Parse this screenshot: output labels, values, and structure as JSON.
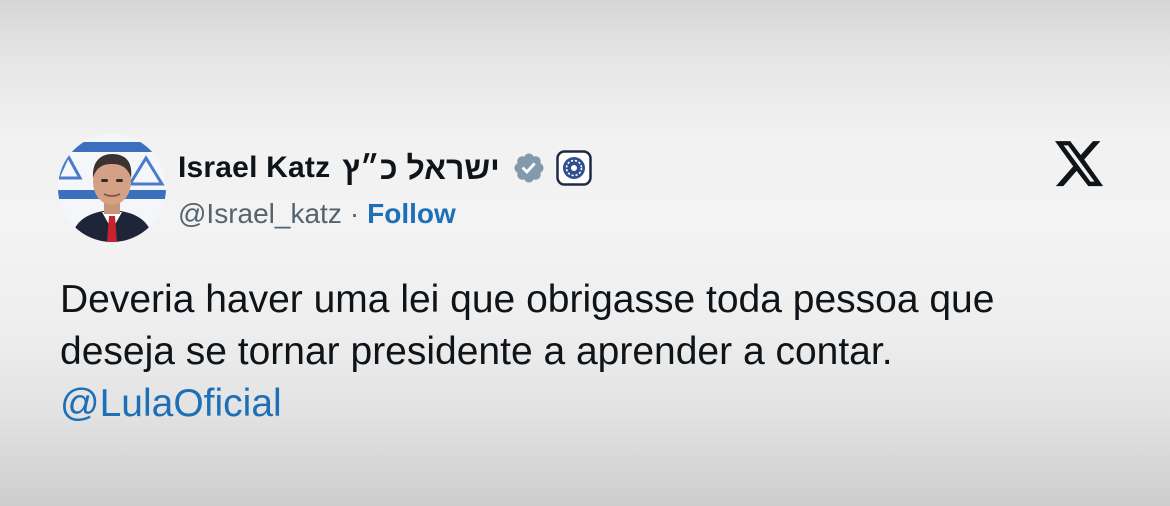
{
  "tweet": {
    "author": {
      "display_name": "Israel Katz",
      "hebrew_name": "ישראל כ״ץ",
      "handle": "@Israel_katz",
      "separator": "·",
      "follow_label": "Follow",
      "verified_icon": "verified-badge-gray",
      "affiliate_icon": "government-affiliate-badge"
    },
    "platform_icon": "x-logo",
    "text_lines": [
      "Deveria haver uma lei que obrigasse toda pessoa que",
      "deseja se tornar presidente a aprender a contar."
    ],
    "mention": "@LulaOficial"
  },
  "colors": {
    "text_primary": "#0f1419",
    "text_secondary": "#536471",
    "link": "#1d6fb8",
    "verified_badge": "#829aab"
  }
}
